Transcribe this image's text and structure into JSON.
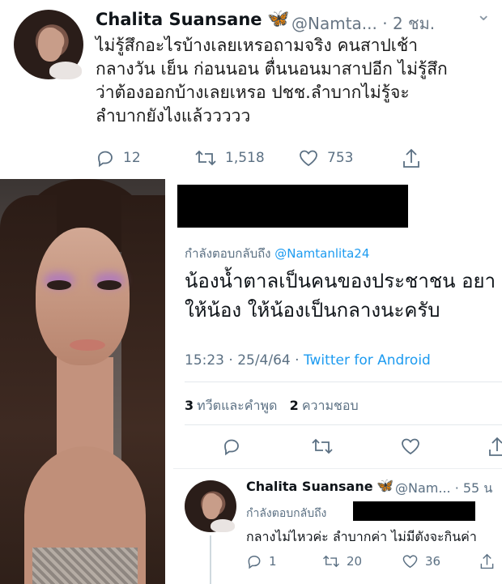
{
  "tweet_top": {
    "name": "Chalita Suansane",
    "badge": "🦋",
    "handle_time": "@Namta... · 2 ชม.",
    "more": "⌄",
    "lines": [
      "ไม่รู้สึกอะไรบ้างเลยเหรอถามจริง คนสาปเช้า",
      "กลางวัน เย็น ก่อนนอน ตื่นนอนมาสาปอีก ไม่รู้สึก",
      "ว่าต้องออกบ้างเลยเหรอ ปชช.ลำบากไม่รู้จะ",
      "ลำบากยังไงแล้ววววว"
    ],
    "replies": "12",
    "retweets": "1,518",
    "likes": "753",
    "icons": [
      "reply-icon",
      "retweet-icon",
      "like-icon",
      "share-icon"
    ]
  },
  "tweet_mid": {
    "reply_prefix": "กำลังตอบกลับถึง ",
    "reply_handle": "@Namtanlita24",
    "lines": [
      "น้องน้ำตาลเป็นคนของประชาชน อยา",
      "ให้น้อง ให้น้องเป็นกลางนะครับ"
    ],
    "time_date": "15:23 · 25/4/64 · ",
    "source": "Twitter for Android",
    "retweet_count": "3",
    "retweet_label": "ทวีตและคำพูด",
    "like_count": "2",
    "like_label": "ความชอบ"
  },
  "tweet_bottom": {
    "name": "Chalita Suansane",
    "badge": "🦋",
    "handle_time": "@Nam... · 55 น",
    "reply_prefix": "กำลังตอบกลับถึง",
    "text": "กลางไม่ไหวค่ะ ลำบากค่า ไม่มีตังจะกินค่า",
    "replies": "1",
    "retweets": "20",
    "likes": "36"
  },
  "colors": {
    "link_blue": "#1d9bf0",
    "muted_gray": "#5b7083",
    "redaction": "#000000"
  }
}
